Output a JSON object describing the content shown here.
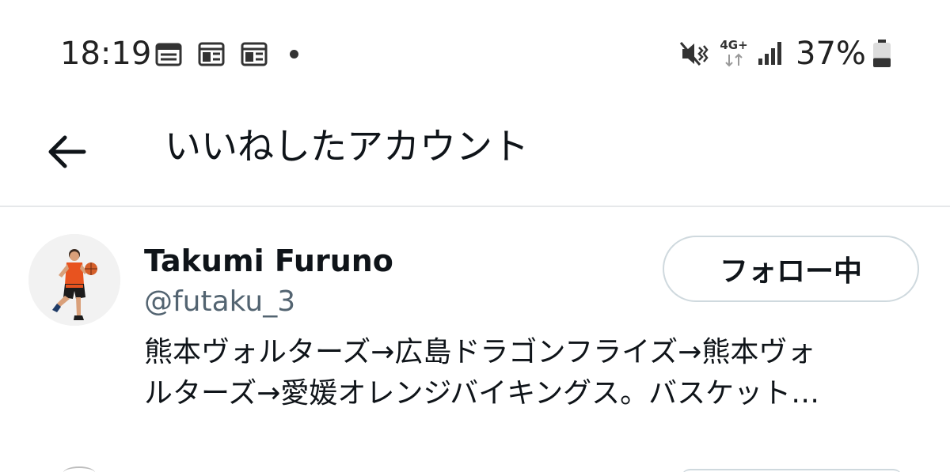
{
  "status_bar": {
    "time": "18:19",
    "notification_icons": [
      "news-icon",
      "news-icon",
      "news-icon"
    ],
    "network_type": "4G+",
    "battery_percent": "37%",
    "battery_level": 0.37
  },
  "header": {
    "title": "いいねしたアカウント",
    "back_icon": "arrow-left-icon"
  },
  "account": {
    "display_name": "Takumi Furuno",
    "handle": "@futaku_3",
    "follow_button_label": "フォロー中",
    "bio_lines": [
      "熊本ヴォルターズ→広島ドラゴンフライズ→熊本ヴォ",
      "ルターズ→愛媛オレンジバイキングス。バスケット…"
    ]
  },
  "colors": {
    "text_primary": "#0f1419",
    "text_secondary": "#536471",
    "divider": "#e6e8ea",
    "button_border": "#cfd9de",
    "jersey_orange": "#e8531f"
  }
}
